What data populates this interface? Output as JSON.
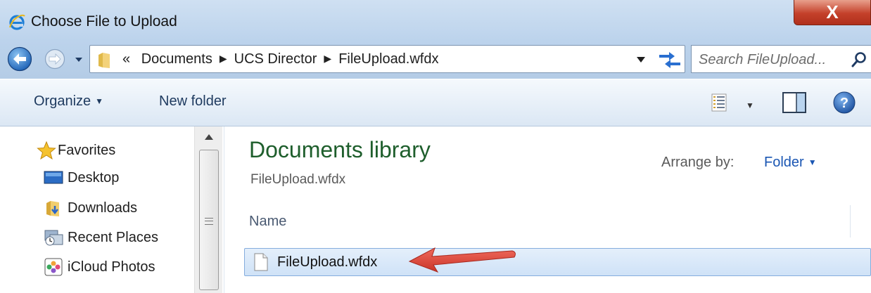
{
  "window": {
    "title": "Choose File to Upload",
    "close_label": "X"
  },
  "address_bar": {
    "overflow_marker": "«",
    "crumbs": [
      "Documents",
      "UCS Director",
      "FileUpload.wfdx"
    ],
    "search_placeholder": "Search FileUpload..."
  },
  "toolbar": {
    "organize_label": "Organize",
    "new_folder_label": "New folder"
  },
  "nav_pane": {
    "items": [
      {
        "label": "Favorites",
        "icon": "star-icon"
      },
      {
        "label": "Desktop",
        "icon": "desktop-icon"
      },
      {
        "label": "Downloads",
        "icon": "downloads-folder-icon"
      },
      {
        "label": "Recent Places",
        "icon": "recent-places-icon"
      },
      {
        "label": "iCloud Photos",
        "icon": "icloud-photos-icon"
      }
    ]
  },
  "content": {
    "library_title": "Documents library",
    "library_subtitle": "FileUpload.wfdx",
    "arrange_by_label": "Arrange by:",
    "arrange_by_value": "Folder",
    "column_header": "Name",
    "files": [
      {
        "name": "FileUpload.wfdx",
        "selected": true
      }
    ]
  },
  "colors": {
    "title_bar": "#c5daf0",
    "library_title": "#1e5e2c",
    "link": "#1a56b3",
    "selection": "#d6e7f9",
    "close_button": "#c4402a",
    "arrow": "#d9473a"
  }
}
